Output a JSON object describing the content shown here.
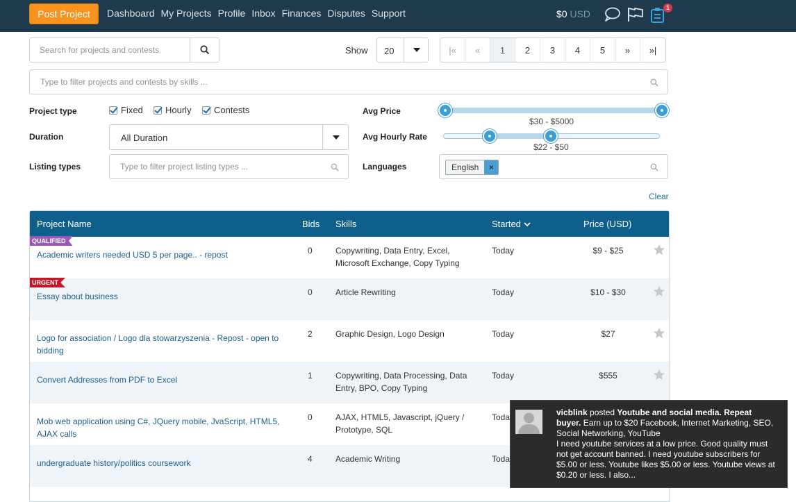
{
  "nav": {
    "post_project": "Post Project",
    "links": [
      "Dashboard",
      "My Projects",
      "Profile",
      "Inbox",
      "Finances",
      "Disputes",
      "Support"
    ],
    "balance_amount": "$0",
    "balance_currency": "USD",
    "notifications_count": "1",
    "icons": [
      "chat-bubble-icon",
      "flag-icon",
      "clipboard-icon"
    ]
  },
  "search": {
    "placeholder": "Search for projects and contests",
    "show_label": "Show",
    "show_value": "20"
  },
  "pagination": {
    "first": "|«",
    "prev": "«",
    "pages": [
      "1",
      "2",
      "3",
      "4",
      "5"
    ],
    "current": "1",
    "next": "»",
    "last": "»|"
  },
  "skills_filter": {
    "placeholder": "Type to filter projects and contests by skills ..."
  },
  "filters": {
    "project_type_label": "Project type",
    "types": [
      "Fixed",
      "Hourly",
      "Contests"
    ],
    "duration_label": "Duration",
    "duration_value": "All Duration",
    "listing_label": "Listing types",
    "listing_placeholder": "Type to filter project listing types ...",
    "avg_price_label": "Avg Price",
    "avg_price_range": "$30 - $5000",
    "avg_hourly_label": "Avg Hourly Rate",
    "avg_hourly_range": "$22 - $50",
    "languages_label": "Languages",
    "language_tag": "English",
    "language_remove": "×",
    "clear": "Clear"
  },
  "table": {
    "headers": {
      "name": "Project Name",
      "bids": "Bids",
      "skills": "Skills",
      "started": "Started",
      "price": "Price (USD)"
    },
    "rows": [
      {
        "ribbon": "QUALIFIED",
        "name": "Academic writers needed USD 5 per page.. - repost",
        "bids": "0",
        "skills": "Copywriting, Data Entry, Excel, Microsoft Exchange, Copy Typing",
        "started": "Today",
        "price": "$9 - $25"
      },
      {
        "ribbon": "URGENT",
        "name": "Essay about business",
        "bids": "0",
        "skills": "Article Rewriting",
        "started": "Today",
        "price": "$10 - $30"
      },
      {
        "ribbon": "",
        "name": "Logo for association / Logo dla stowarzyszenia - Repost - open to bidding",
        "bids": "2",
        "skills": "Graphic Design, Logo Design",
        "started": "Today",
        "price": "$27"
      },
      {
        "ribbon": "",
        "name": "Convert Addresses from PDF to Excel",
        "bids": "1",
        "skills": "Copywriting, Data Processing, Data Entry, BPO, Copy Typing",
        "started": "Today",
        "price": "$555"
      },
      {
        "ribbon": "",
        "name": "Mob web application using C#, JQuery mobile, JvaScript, HTML5, AJAX calls",
        "bids": "0",
        "skills": "AJAX, HTML5, Javascript, jQuery / Prototype, SQL",
        "started": "Toda",
        "price": ""
      },
      {
        "ribbon": "",
        "name": "undergraduate history/politics coursework",
        "bids": "4",
        "skills": "Academic Writing",
        "started": "Toda",
        "price": ""
      }
    ]
  },
  "notification": {
    "user": "vicblink",
    "verb": " posted ",
    "title": "Youtube and social media. Repeat buyer.",
    "body": " Earn up to $20 Facebook, Internet Marketing, SEO, Social Networking, YouTube",
    "body2": "I need youtube services at a low price. Good quality must not get account banned. I need youtube subscribers for $5.00 or less. Youtube likes $5.00 or less. Youtube views at $0.20 or less. I also..."
  },
  "colors": {
    "nav_bg": "#1f3a4d",
    "accent_orange": "#f7931e",
    "table_header": "#0e5f8c",
    "link": "#1b5f8c",
    "qualified": "#9b59b6",
    "urgent": "#c0182b"
  }
}
